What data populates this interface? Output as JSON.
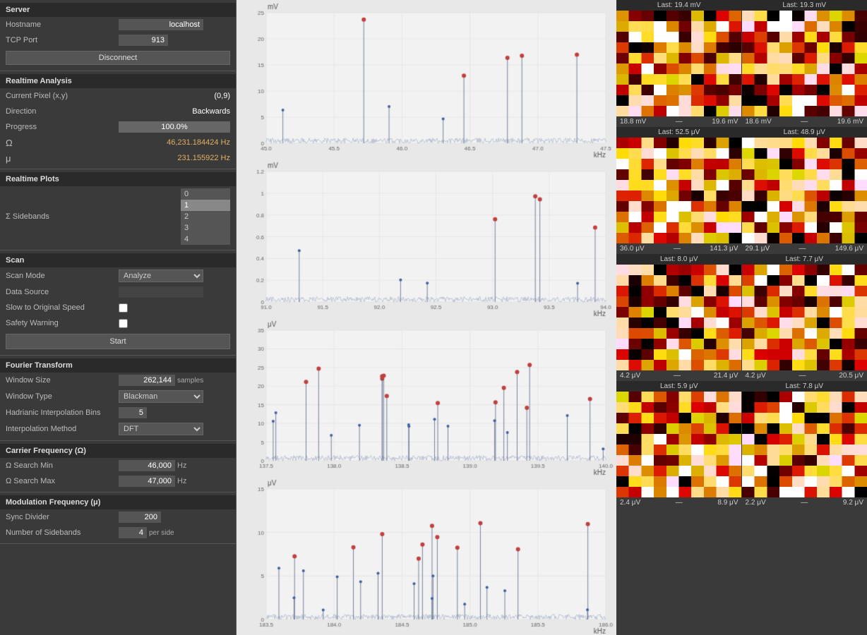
{
  "server": {
    "title": "Server",
    "hostname_label": "Hostname",
    "hostname_value": "localhost",
    "tcp_port_label": "TCP Port",
    "tcp_port_value": "913",
    "disconnect_btn": "Disconnect"
  },
  "realtime_analysis": {
    "title": "Realtime Analysis",
    "current_pixel_label": "Current Pixel (x,y)",
    "current_pixel_value": "(0,9)",
    "direction_label": "Direction",
    "direction_value": "Backwards",
    "progress_label": "Progress",
    "progress_value": "100.0%",
    "omega_label": "Ω",
    "omega_value": "46,231.184424 Hz",
    "mu_label": "μ",
    "mu_value": "231.155922 Hz"
  },
  "realtime_plots": {
    "title": "Realtime Plots",
    "sidebands_label": "Σ Sidebands",
    "sidebands_options": [
      "0",
      "1",
      "2",
      "3",
      "4"
    ],
    "sidebands_selected": "1"
  },
  "scan": {
    "title": "Scan",
    "scan_mode_label": "Scan Mode",
    "scan_mode_value": "Analyze",
    "data_source_label": "Data Source",
    "slow_speed_label": "Slow to Original Speed",
    "safety_warning_label": "Safety Warning",
    "start_btn": "Start"
  },
  "fourier": {
    "title": "Fourier Transform",
    "window_size_label": "Window Size",
    "window_size_value": "262,144",
    "window_size_unit": "samples",
    "window_type_label": "Window Type",
    "window_type_value": "Blackman",
    "interpolation_bins_label": "Hadrianic Interpolation Bins",
    "interpolation_bins_value": "5",
    "interpolation_method_label": "Interpolation Method",
    "interpolation_method_value": "DFT"
  },
  "carrier_freq": {
    "title": "Carrier Frequency (Ω)",
    "search_min_label": "Ω Search Min",
    "search_min_value": "46,000",
    "search_min_unit": "Hz",
    "search_max_label": "Ω Search Max",
    "search_max_value": "47,000",
    "search_max_unit": "Hz"
  },
  "modulation_freq": {
    "title": "Modulation Frequency (μ)",
    "sync_divider_label": "Sync Divider",
    "sync_divider_value": "200",
    "num_sidebands_label": "Number of Sidebands",
    "num_sidebands_value": "4",
    "num_sidebands_unit": "per side"
  },
  "charts": [
    {
      "id": "chart1",
      "y_unit": "mV",
      "y_max": 25,
      "y_ticks": [
        0,
        5,
        10,
        15,
        20,
        25
      ],
      "x_min": 45.0,
      "x_max": 47.5,
      "x_unit": "kHz",
      "x_ticks": [
        "45.0",
        "45.5",
        "46.0",
        "46.5",
        "47.0",
        "47.5"
      ]
    },
    {
      "id": "chart2",
      "y_unit": "mV",
      "y_max": 1.2,
      "y_ticks": [
        0,
        0.2,
        0.4,
        0.6,
        0.8,
        1.0,
        1.2
      ],
      "x_min": 91.0,
      "x_max": 94.0,
      "x_unit": "kHz",
      "x_ticks": [
        "91.0",
        "91.5",
        "92.0",
        "92.5",
        "93.0",
        "93.5",
        "94.0"
      ]
    },
    {
      "id": "chart3",
      "y_unit": "μV",
      "y_max": 35,
      "y_ticks": [
        0,
        5,
        10,
        15,
        20,
        25,
        30,
        35
      ],
      "x_min": 137.5,
      "x_max": 140.0,
      "x_unit": "kHz",
      "x_ticks": [
        "137.5",
        "138.0",
        "138.5",
        "139.0",
        "139.5",
        "140.0"
      ]
    },
    {
      "id": "chart4",
      "y_unit": "μV",
      "y_max": 15,
      "y_ticks": [
        0,
        5,
        10,
        15
      ],
      "x_min": 183.5,
      "x_max": 186.0,
      "x_unit": "kHz",
      "x_ticks": [
        "183.5",
        "184.0",
        "184.5",
        "185.0",
        "185.5",
        "186.0"
      ]
    }
  ],
  "heatmaps": [
    {
      "top_label": "Last: 19.4 mV",
      "bottom_min": "18.8 mV",
      "bottom_dash": "—",
      "bottom_max": "19.6 mV",
      "seed": 1
    },
    {
      "top_label": "Last: 19.3 mV",
      "bottom_min": "18.6 mV",
      "bottom_dash": "—",
      "bottom_max": "19.6 mV",
      "seed": 2
    },
    {
      "top_label": "Last: 52.5 μV",
      "bottom_min": "36.0 μV",
      "bottom_dash": "—",
      "bottom_max": "141.3 μV",
      "seed": 3
    },
    {
      "top_label": "Last: 48.9 μV",
      "bottom_min": "29.1 μV",
      "bottom_dash": "—",
      "bottom_max": "149.6 μV",
      "seed": 4
    },
    {
      "top_label": "Last: 8.0 μV",
      "bottom_min": "4.2 μV",
      "bottom_dash": "—",
      "bottom_max": "21.4 μV",
      "seed": 5
    },
    {
      "top_label": "Last: 7.7 μV",
      "bottom_min": "4.2 μV",
      "bottom_dash": "—",
      "bottom_max": "20.5 μV",
      "seed": 6
    },
    {
      "top_label": "Last: 5.9 μV",
      "bottom_min": "2.4 μV",
      "bottom_dash": "—",
      "bottom_max": "8.9 μV",
      "seed": 7
    },
    {
      "top_label": "Last: 7.8 μV",
      "bottom_min": "2.2 μV",
      "bottom_dash": "—",
      "bottom_max": "9.2 μV",
      "seed": 8
    }
  ]
}
